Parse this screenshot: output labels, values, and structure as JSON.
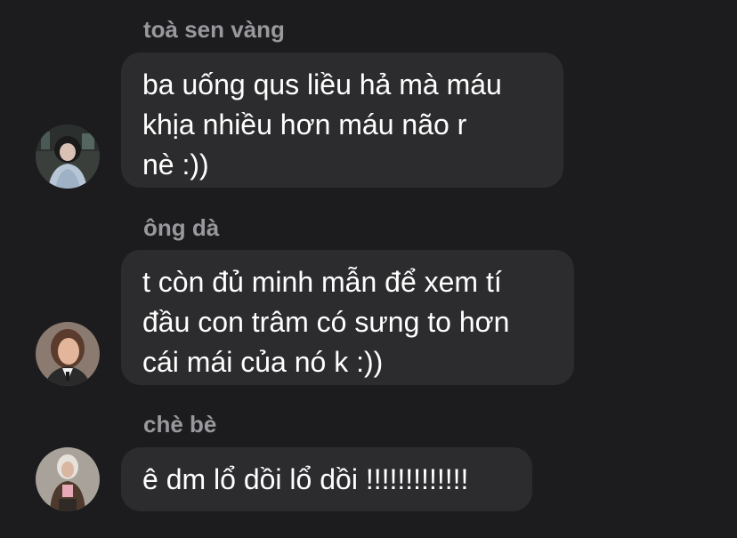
{
  "messages": [
    {
      "sender": "toà sen vàng",
      "lines": [
        "ba uống qus liều hả mà máu",
        "khịa nhiều hơn máu não r",
        "nè :))"
      ],
      "avatar_icon": "person-photo-avatar-icon"
    },
    {
      "sender": "ông dà",
      "lines": [
        "t còn đủ minh mẫn để xem tí",
        "đầu con trâm có sưng to hơn",
        "cái mái của nó k :))"
      ],
      "avatar_icon": "person-photo-avatar-icon"
    },
    {
      "sender": "chè bè",
      "lines": [
        "ê dm lổ dồi lổ dồi !!!!!!!!!!!!!"
      ],
      "avatar_icon": "person-photo-avatar-icon"
    }
  ],
  "colors": {
    "background": "#1c1c1e",
    "bubble": "#2c2c2e",
    "sender_name": "#98989d",
    "message_text": "#ffffff"
  }
}
